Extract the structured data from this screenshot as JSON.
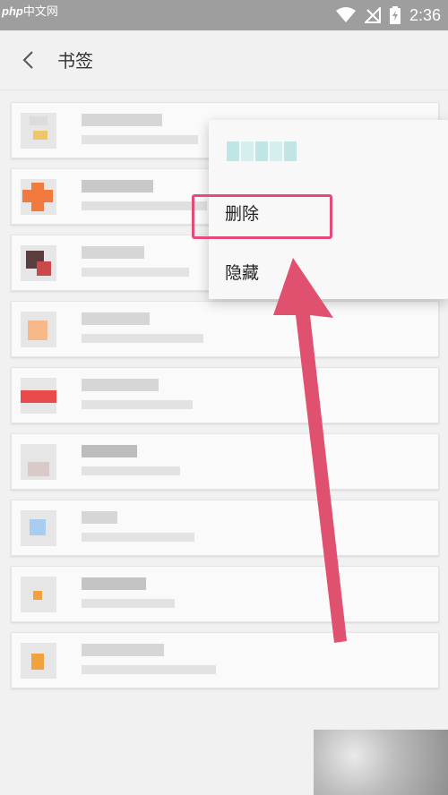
{
  "status_bar": {
    "watermark_php": "php",
    "watermark_site": "中文网",
    "time": "2:36"
  },
  "header": {
    "title": "书签"
  },
  "context_menu": {
    "items": [
      {
        "label": "删除"
      },
      {
        "label": "隐藏"
      }
    ]
  },
  "colors": {
    "highlight": "#e64a78",
    "arrow": "#e0506f"
  }
}
